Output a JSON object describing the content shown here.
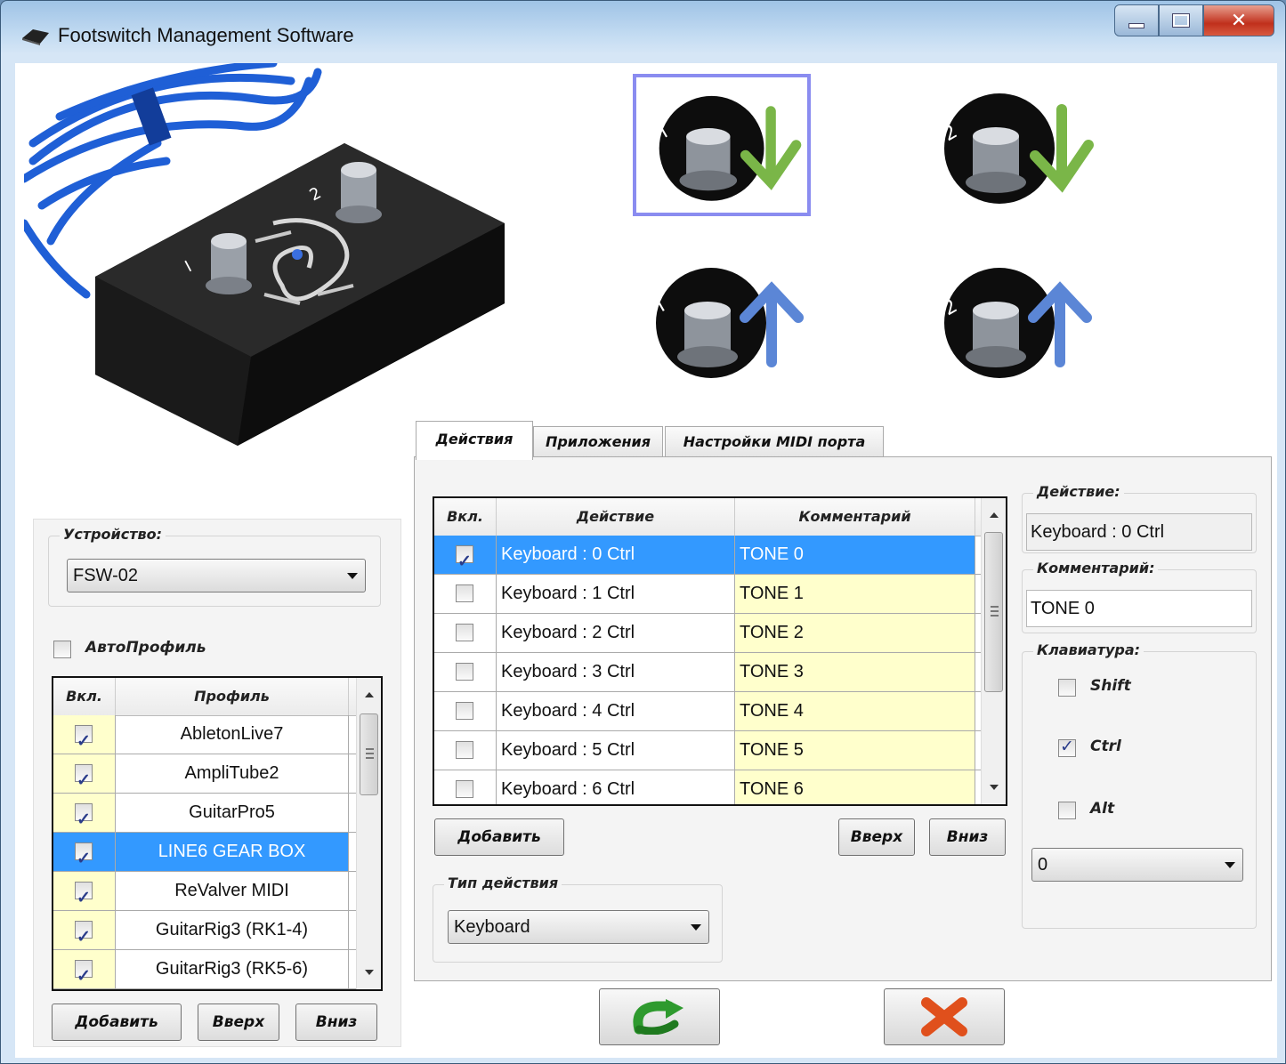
{
  "window": {
    "title": "Footswitch Management Software",
    "controls": {
      "minimize": "min",
      "maximize": "max",
      "close": "✕"
    }
  },
  "device_group": {
    "title": "Устройство:",
    "selected": "FSW-02"
  },
  "auto_profile": {
    "label": "АвтоПрофиль",
    "checked": false
  },
  "profiles": {
    "headers": {
      "enabled": "Вкл.",
      "name": "Профиль"
    },
    "rows": [
      {
        "enabled": true,
        "name": "AbletonLive7"
      },
      {
        "enabled": true,
        "name": "AmpliTube2"
      },
      {
        "enabled": true,
        "name": "GuitarPro5"
      },
      {
        "enabled": true,
        "name": "LINE6 GEAR BOX",
        "selected": true
      },
      {
        "enabled": true,
        "name": "ReValver MIDI"
      },
      {
        "enabled": true,
        "name": "GuitarRig3 (RK1-4)"
      },
      {
        "enabled": true,
        "name": "GuitarRig3 (RK5-6)"
      }
    ],
    "buttons": {
      "add": "Добавить",
      "up": "Вверх",
      "down": "Вниз"
    }
  },
  "tabs": [
    {
      "label": "Действия",
      "active": true
    },
    {
      "label": "Приложения",
      "active": false
    },
    {
      "label": "Настройки MIDI порта",
      "active": false
    }
  ],
  "actions": {
    "headers": {
      "enabled": "Вкл.",
      "action": "Действие",
      "comment": "Комментарий"
    },
    "rows": [
      {
        "enabled": true,
        "action": "Keyboard : 0  Ctrl",
        "comment": "TONE 0",
        "selected": true
      },
      {
        "enabled": false,
        "action": "Keyboard : 1  Ctrl",
        "comment": "TONE 1"
      },
      {
        "enabled": false,
        "action": "Keyboard : 2  Ctrl",
        "comment": "TONE 2"
      },
      {
        "enabled": false,
        "action": "Keyboard : 3  Ctrl",
        "comment": "TONE 3"
      },
      {
        "enabled": false,
        "action": "Keyboard : 4  Ctrl",
        "comment": "TONE 4"
      },
      {
        "enabled": false,
        "action": "Keyboard : 5  Ctrl",
        "comment": "TONE 5"
      },
      {
        "enabled": false,
        "action": "Keyboard : 6  Ctrl",
        "comment": "TONE 6"
      }
    ],
    "buttons": {
      "add": "Добавить",
      "up": "Вверх",
      "down": "Вниз"
    }
  },
  "action_type": {
    "title": "Тип действия",
    "selected": "Keyboard"
  },
  "detail": {
    "action_title": "Действие:",
    "action_value": "Keyboard : 0  Ctrl",
    "comment_title": "Комментарий:",
    "comment_value": "TONE 0",
    "keyboard_title": "Клавиатура:",
    "shift": {
      "label": "Shift",
      "checked": false
    },
    "ctrl": {
      "label": "Ctrl",
      "checked": true
    },
    "alt": {
      "label": "Alt",
      "checked": false
    },
    "key_selected": "0"
  },
  "pedals": [
    {
      "name": "pedal-1-down",
      "number": "1",
      "direction": "down"
    },
    {
      "name": "pedal-2-down",
      "number": "2",
      "direction": "down"
    },
    {
      "name": "pedal-1-up",
      "number": "1",
      "direction": "up"
    },
    {
      "name": "pedal-2-up",
      "number": "2",
      "direction": "up"
    }
  ],
  "colors": {
    "selection": "#3399ff",
    "cell_yellow": "#ffffcc",
    "arrow_down": "#7ab648",
    "arrow_up": "#5b86d6",
    "ok_icon": "#2e9a2e",
    "cancel_icon": "#e0501c"
  }
}
